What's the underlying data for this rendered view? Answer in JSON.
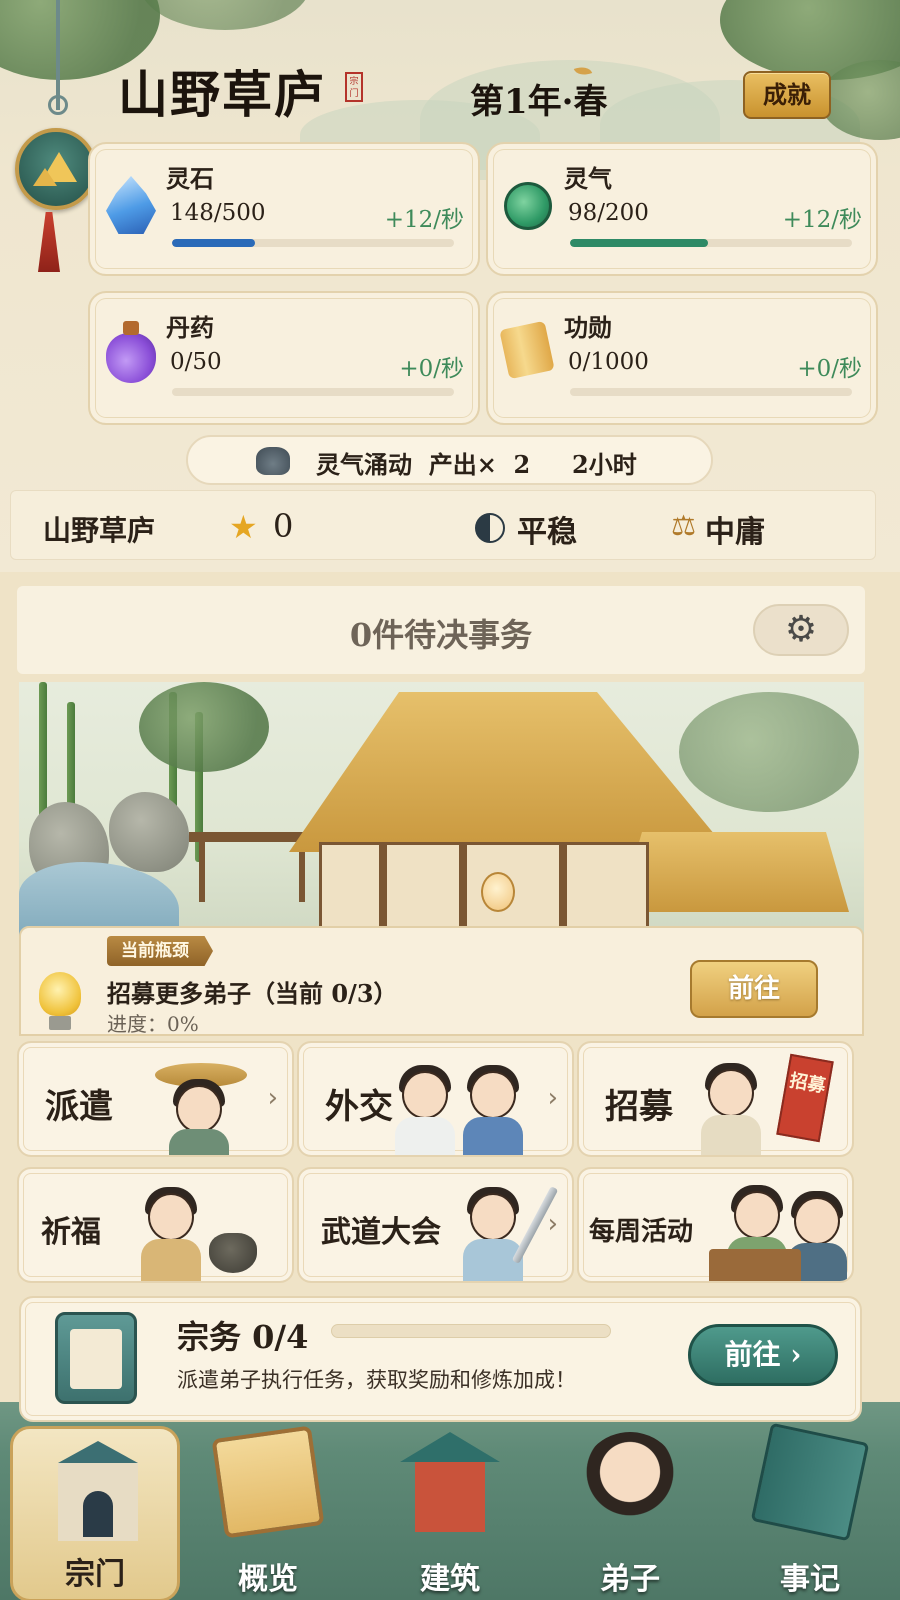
{
  "header": {
    "title": "山野草庐",
    "title_seal": "宗门",
    "season": "第1年·春",
    "achievement_label": "成就"
  },
  "resources": [
    {
      "name": "灵石",
      "value": "148/500",
      "rate": "+12/秒",
      "fill": 0.296,
      "color": "#2a6ab8",
      "icon": "spirit-stone-icon"
    },
    {
      "name": "灵气",
      "value": "98/200",
      "rate": "+12/秒",
      "fill": 0.49,
      "color": "#2e8a66",
      "icon": "spirit-qi-icon"
    },
    {
      "name": "丹药",
      "value": "0/50",
      "rate": "+0/秒",
      "fill": 0,
      "color": "#8b4fd8",
      "icon": "elixir-icon"
    },
    {
      "name": "功勋",
      "value": "0/1000",
      "rate": "+0/秒",
      "fill": 0,
      "color": "#d5a24a",
      "icon": "merit-scroll-icon"
    }
  ],
  "buff": {
    "text": "灵气涌动  产出×  2     2小时",
    "icon": "incense-burner-icon"
  },
  "status": {
    "sect_name": "山野草庐",
    "reputation_icon": "★",
    "reputation": "0",
    "stability": "平稳",
    "alignment_icon": "⚖",
    "alignment": "中庸"
  },
  "pending": {
    "text": "0件待决事务",
    "settings_icon": "⚙"
  },
  "bottleneck": {
    "tag": "当前瓶颈",
    "text": "招募更多弟子（当前 0/3）",
    "progress": "进度：0%",
    "go_label": "前往"
  },
  "features": [
    {
      "label": "派遣",
      "chevron": "›"
    },
    {
      "label": "外交",
      "chevron": "›"
    },
    {
      "label": "招募",
      "banner": "招募"
    },
    {
      "label": "祈福"
    },
    {
      "label": "武道大会",
      "chevron": "›"
    },
    {
      "label": "每周活动"
    }
  ],
  "quest": {
    "title": "宗务 0/4",
    "progress": 0,
    "desc": "派遣弟子执行任务，获取奖励和修炼加成！",
    "go_label": "前往 ›"
  },
  "nav": [
    {
      "label": "宗门",
      "active": true
    },
    {
      "label": "概览",
      "active": false
    },
    {
      "label": "建筑",
      "active": false
    },
    {
      "label": "弟子",
      "active": false
    },
    {
      "label": "事记",
      "active": false
    }
  ],
  "colors": {
    "accent_gold": "#d3a24a",
    "accent_teal": "#2e6e62",
    "positive_rate": "#3e8a5a"
  }
}
